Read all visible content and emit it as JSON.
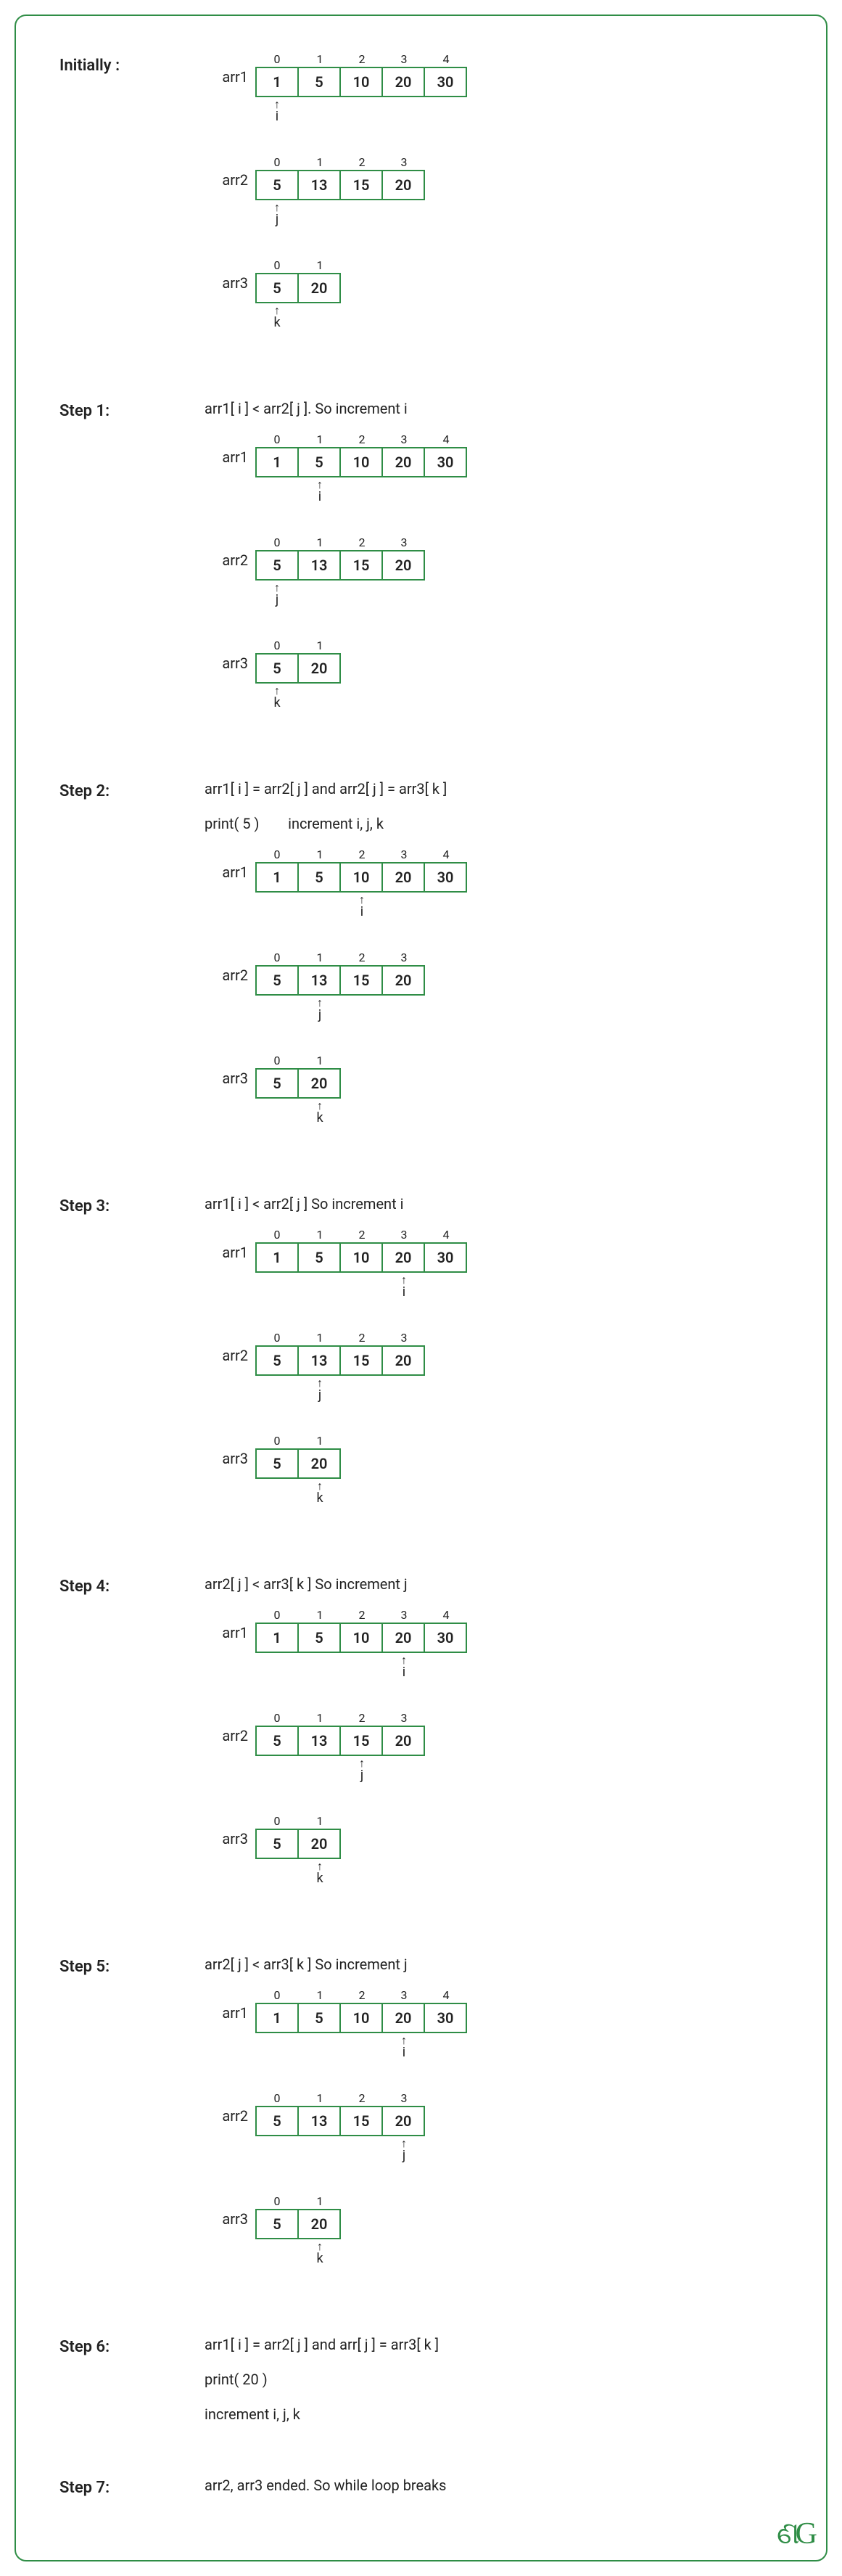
{
  "chart_data": {
    "type": "table",
    "title": "Three-pointer common-element walkthrough on three sorted arrays",
    "arrays": {
      "arr1": [
        1,
        5,
        10,
        20,
        30
      ],
      "arr2": [
        5,
        13,
        15,
        20
      ],
      "arr3": [
        5,
        20
      ]
    },
    "pointer_vars": {
      "arr1": "i",
      "arr2": "j",
      "arr3": "k"
    },
    "steps": [
      {
        "title": "Initially :",
        "caption": [],
        "show_arrays": true,
        "ptr": {
          "arr1": 0,
          "arr2": 0,
          "arr3": 0
        }
      },
      {
        "title": "Step 1:",
        "caption": [
          "arr1[ i ] < arr2[ j ]. So increment i"
        ],
        "show_arrays": true,
        "ptr": {
          "arr1": 1,
          "arr2": 0,
          "arr3": 0
        }
      },
      {
        "title": "Step 2:",
        "caption": [
          "arr1[ i ] = arr2[ j ] and arr2[ j ] = arr3[ k ]",
          "print( 5 )        increment i, j, k"
        ],
        "show_arrays": true,
        "ptr": {
          "arr1": 2,
          "arr2": 1,
          "arr3": 1
        }
      },
      {
        "title": "Step 3:",
        "caption": [
          "arr1[ i ] < arr2[ j ] So increment i"
        ],
        "show_arrays": true,
        "ptr": {
          "arr1": 3,
          "arr2": 1,
          "arr3": 1
        }
      },
      {
        "title": "Step 4:",
        "caption": [
          "arr2[ j ] < arr3[ k ] So increment j"
        ],
        "show_arrays": true,
        "ptr": {
          "arr1": 3,
          "arr2": 2,
          "arr3": 1
        }
      },
      {
        "title": "Step 5:",
        "caption": [
          "arr2[ j ] < arr3[ k ] So increment j"
        ],
        "show_arrays": true,
        "ptr": {
          "arr1": 3,
          "arr2": 3,
          "arr3": 1
        }
      },
      {
        "title": "Step 6:",
        "caption": [
          "arr1[ i ] = arr2[ j ] and arr[ j ] = arr3[ k ]",
          "print( 20 )",
          "increment i, j, k"
        ],
        "show_arrays": false
      },
      {
        "title": "Step 7:",
        "caption": [
          "arr2, arr3 ended. So while loop breaks"
        ],
        "show_arrays": false
      }
    ]
  },
  "logo": "ଣG"
}
